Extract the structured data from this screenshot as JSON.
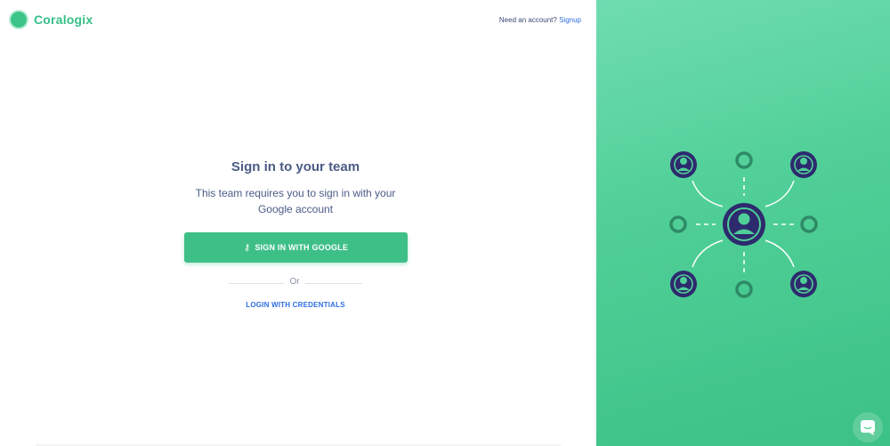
{
  "brand": {
    "name": "Coralogix"
  },
  "header": {
    "need_account_text": "Need an account?",
    "signup_link": "Signup"
  },
  "main": {
    "title": "Sign in to your team",
    "subtitle": "This team requires you to sign in with your Google account",
    "google_button_label": "SIGN IN WITH GOOGLE",
    "or_text": "Or",
    "credentials_link": "LOGIN WITH CREDENTIALS"
  },
  "illustration": {
    "name": "team-network-illustration"
  },
  "colors": {
    "brand_green": "#3dc589",
    "button_green": "#3fbf88",
    "link_blue": "#2f6de1",
    "text_navy": "#4b5b86",
    "illustration_navy": "#2e2a6e",
    "panel_green": "#4fcf97"
  },
  "chat": {
    "icon": "chat-icon"
  }
}
